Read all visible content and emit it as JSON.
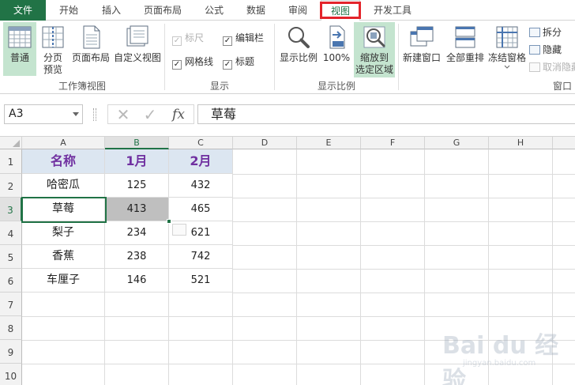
{
  "tabs": [
    {
      "id": "file",
      "label": "文件"
    },
    {
      "id": "home",
      "label": "开始"
    },
    {
      "id": "insert",
      "label": "插入"
    },
    {
      "id": "layout",
      "label": "页面布局"
    },
    {
      "id": "formulas",
      "label": "公式"
    },
    {
      "id": "data",
      "label": "数据"
    },
    {
      "id": "review",
      "label": "审阅"
    },
    {
      "id": "view",
      "label": "视图"
    },
    {
      "id": "developer",
      "label": "开发工具"
    }
  ],
  "ribbon": {
    "workbook_views": {
      "normal": "普通",
      "page_break_1": "分页",
      "page_break_2": "预览",
      "page_layout": "页面布局",
      "custom_views": "自定义视图",
      "group_label": "工作簿视图"
    },
    "show": {
      "ruler": "标尺",
      "formula_bar": "编辑栏",
      "gridlines": "网格线",
      "headings": "标题",
      "group_label": "显示"
    },
    "zoom": {
      "zoom": "显示比例",
      "hundred": "100%",
      "zoom_selection_1": "缩放到",
      "zoom_selection_2": "选定区域",
      "group_label": "显示比例"
    },
    "window": {
      "new_window": "新建窗口",
      "arrange_all": "全部重排",
      "freeze_panes": "冻结窗格",
      "split": "拆分",
      "hide": "隐藏",
      "unhide": "取消隐藏",
      "group_label": "窗口"
    }
  },
  "formula_bar": {
    "name_box": "A3",
    "cancel": "✕",
    "enter": "✓",
    "fx": "fx",
    "content": "草莓"
  },
  "columns": [
    "A",
    "B",
    "C",
    "D",
    "E",
    "F",
    "G",
    "H"
  ],
  "rows": [
    "1",
    "2",
    "3",
    "4",
    "5",
    "6",
    "7",
    "8",
    "9",
    "10"
  ],
  "table": {
    "header": [
      "名称",
      "1月",
      "2月"
    ],
    "body": [
      [
        "哈密瓜",
        "125",
        "432"
      ],
      [
        "草莓",
        "413",
        "465"
      ],
      [
        "梨子",
        "234",
        "621"
      ],
      [
        "香蕉",
        "238",
        "742"
      ],
      [
        "车厘子",
        "146",
        "521"
      ]
    ]
  },
  "watermark": {
    "brand": "Bai du 经验",
    "url": "jingyan.baidu.com"
  },
  "colors": {
    "excel_green": "#217346",
    "header_fill": "#dce6f1",
    "header_text": "#7030a0",
    "highlight_red": "#e3242b",
    "selected_cell_fill": "#bfbfbf"
  }
}
